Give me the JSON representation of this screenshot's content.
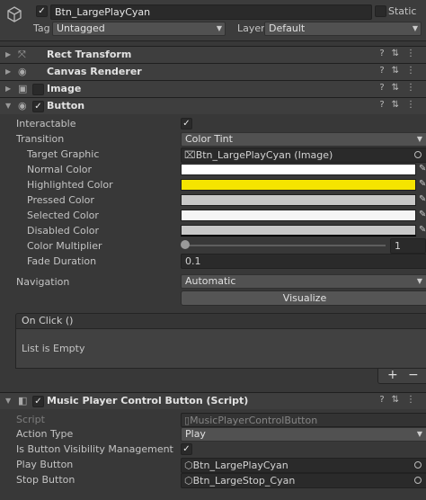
{
  "header": {
    "object_name": "Btn_LargePlayCyan",
    "static_label": "Static",
    "tag_label": "Tag",
    "tag_value": "Untagged",
    "layer_label": "Layer",
    "layer_value": "Default"
  },
  "components": {
    "rect_transform": "Rect Transform",
    "canvas_renderer": "Canvas Renderer",
    "image": "Image",
    "button": "Button",
    "script": "Music Player Control Button (Script)"
  },
  "button": {
    "interactable_label": "Interactable",
    "interactable": true,
    "transition_label": "Transition",
    "transition_value": "Color Tint",
    "target_graphic_label": "Target Graphic",
    "target_graphic_value": "Btn_LargePlayCyan (Image)",
    "normal_color_label": "Normal Color",
    "highlighted_color_label": "Highlighted Color",
    "pressed_color_label": "Pressed Color",
    "selected_color_label": "Selected Color",
    "disabled_color_label": "Disabled Color",
    "color_multiplier_label": "Color Multiplier",
    "color_multiplier_value": "1",
    "fade_duration_label": "Fade Duration",
    "fade_duration_value": "0.1",
    "navigation_label": "Navigation",
    "navigation_value": "Automatic",
    "visualize_label": "Visualize",
    "onclick_label": "On Click ()",
    "list_empty": "List is Empty",
    "add_label": "+",
    "remove_label": "−"
  },
  "colors": {
    "normal": "#ffffff",
    "highlighted": "#f5e400",
    "pressed": "#c8c8c8",
    "selected": "#f5f5f5",
    "disabled": "#c8c8c8"
  },
  "script_comp": {
    "script_label": "Script",
    "script_value": "MusicPlayerControlButton",
    "action_type_label": "Action Type",
    "action_type_value": "Play",
    "visibility_label": "Is Button Visibility Management",
    "visibility_checked": true,
    "play_button_label": "Play Button",
    "play_button_value": "Btn_LargePlayCyan",
    "stop_button_label": "Stop Button",
    "stop_button_value": "Btn_LargeStop_Cyan"
  }
}
